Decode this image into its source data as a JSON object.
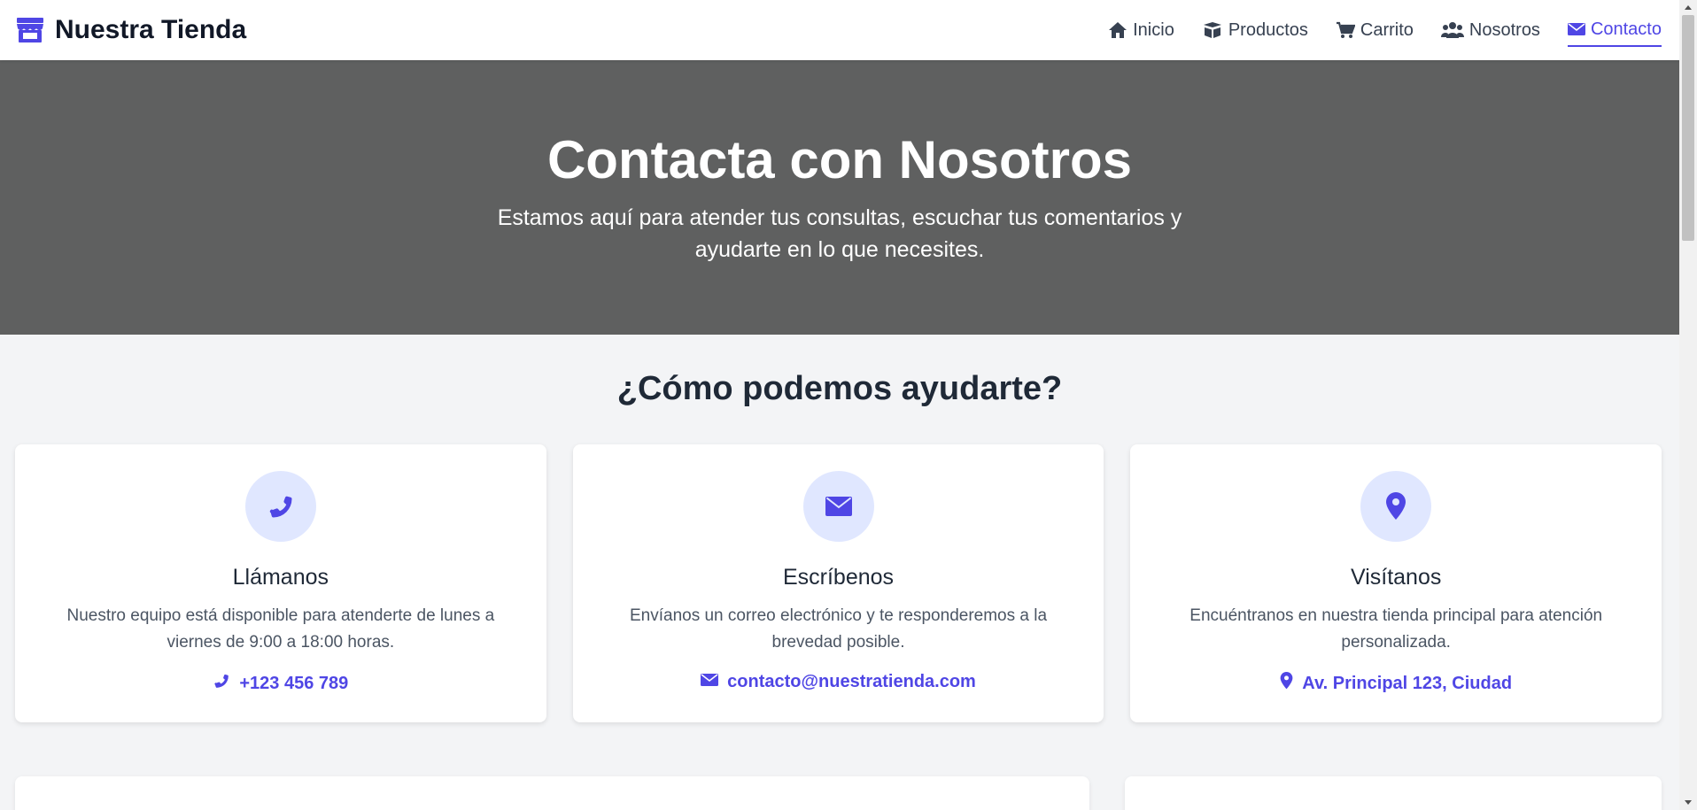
{
  "brand": {
    "name": "Nuestra Tienda",
    "icon": "store-icon"
  },
  "nav": [
    {
      "label": "Inicio",
      "icon": "home-icon",
      "active": false
    },
    {
      "label": "Productos",
      "icon": "box-icon",
      "active": false
    },
    {
      "label": "Carrito",
      "icon": "cart-icon",
      "active": false
    },
    {
      "label": "Nosotros",
      "icon": "users-icon",
      "active": false
    },
    {
      "label": "Contacto",
      "icon": "envelope-icon",
      "active": true
    }
  ],
  "hero": {
    "title": "Contacta con Nosotros",
    "subtitle": "Estamos aquí para atender tus consultas, escuchar tus comentarios y ayudarte en lo que necesites."
  },
  "help": {
    "title": "¿Cómo podemos ayudarte?",
    "cards": [
      {
        "icon": "phone-icon",
        "title": "Llámanos",
        "text": "Nuestro equipo está disponible para atenderte de lunes a viernes de 9:00 a 18:00 horas.",
        "link": "+123 456 789"
      },
      {
        "icon": "envelope-icon",
        "title": "Escríbenos",
        "text": "Envíanos un correo electrónico y te responderemos a la brevedad posible.",
        "link": "contacto@nuestratienda.com"
      },
      {
        "icon": "map-marker-icon",
        "title": "Visítanos",
        "text": "Encuéntranos en nuestra tienda principal para atención personalizada.",
        "link": "Av. Principal 123, Ciudad"
      }
    ]
  },
  "colors": {
    "accent": "#4f46e5",
    "accent_soft": "#e0e7ff",
    "hero_bg": "#5f6060",
    "page_bg": "#f3f4f6"
  }
}
